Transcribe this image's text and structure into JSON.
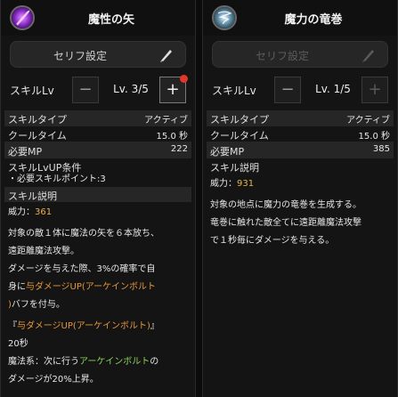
{
  "left": {
    "title": "魔性の矢",
    "serif_label": "セリフ設定",
    "lv_label": "スキルLv",
    "lv_value": "Lv. 3/5",
    "minus": "−",
    "plus": "+",
    "stats": [
      {
        "k": "スキルタイプ",
        "v": "アクティブ"
      },
      {
        "k": "クールタイム",
        "v": "15.0 秒"
      },
      {
        "k": "必要MP",
        "v": "222"
      }
    ],
    "lvup_title": "スキルLvUP条件",
    "lvup_req": "・必要スキルポイント:3",
    "desc_title": "スキル説明",
    "power_label": "威力：",
    "power_value": "361",
    "desc_lines": [
      "対象の敵１体に魔法の矢を６本放ち、",
      "遠距離魔法攻撃。",
      "ダメージを与えた際、3%の確率で自"
    ],
    "desc4_a": "身に",
    "desc4_b": "与ダメージUP(アーケインボルト",
    "desc5_a": ")",
    "desc5_b": "バフを付与。",
    "buff_a": "『",
    "buff_b": "与ダメージUP(アーケインボルト)",
    "buff_c": "』",
    "buff_duration": "20秒",
    "magic_a": "魔法系：次に行う",
    "magic_b": "アーケインボルト",
    "magic_c": "の",
    "magic_last": "ダメージが20%上昇。"
  },
  "right": {
    "title": "魔力の竜巻",
    "serif_label": "セリフ設定",
    "lv_label": "スキルLv",
    "lv_value": "Lv. 1/5",
    "minus": "−",
    "plus": "+",
    "stats": [
      {
        "k": "スキルタイプ",
        "v": "アクティブ"
      },
      {
        "k": "クールタイム",
        "v": "15.0 秒"
      },
      {
        "k": "必要MP",
        "v": "385"
      }
    ],
    "desc_title": "スキル説明",
    "power_label": "威力：",
    "power_value": "931",
    "desc_lines": [
      "対象の地点に魔力の竜巻を生成する。",
      "竜巻に触れた敵全てに遠距離魔法攻撃",
      "で１秒毎にダメージを与える。"
    ]
  },
  "colors": {
    "accent_gold": "#e6b24a",
    "highlight_orange": "#e6963a",
    "highlight_green": "#8cd25a",
    "notification_red": "#e0362c"
  },
  "icons": {
    "left_skill": "arcane-arrow-icon",
    "right_skill": "magic-tornado-icon",
    "serif_edit": "quill-pen-icon"
  }
}
